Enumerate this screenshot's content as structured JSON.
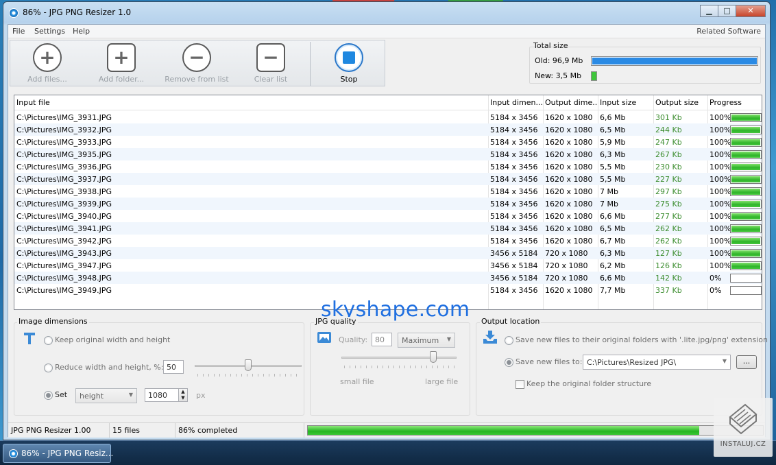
{
  "window": {
    "title": "86% - JPG PNG Resizer 1.0",
    "controls": {
      "minimize": "▁",
      "maximize": "□",
      "close": "✕"
    }
  },
  "menu": {
    "items": [
      "File",
      "Settings",
      "Help"
    ],
    "right": "Related Software"
  },
  "toolbar": {
    "add_files": "Add files...",
    "add_folder": "Add folder...",
    "remove": "Remove from list",
    "clear": "Clear list",
    "stop": "Stop"
  },
  "total_size": {
    "label": "Total size",
    "old_label": "Old: 96,9 Mb",
    "new_label": "New: 3,5 Mb",
    "old_fraction": 1.0,
    "new_fraction": 0.036,
    "old_color": "#2a8ae4",
    "new_color": "#3fc63b"
  },
  "table": {
    "columns": [
      "Input file",
      "Input dimen...",
      "Output dime...",
      "Input size",
      "Output size",
      "Progress"
    ],
    "rows": [
      {
        "file": "C:\\Pictures\\IMG_3931.JPG",
        "in_dim": "5184 x 3456",
        "out_dim": "1620 x 1080",
        "in_size": "6,6 Mb",
        "out_size": "301 Kb",
        "progress": "100%",
        "pct": 100
      },
      {
        "file": "C:\\Pictures\\IMG_3932.JPG",
        "in_dim": "5184 x 3456",
        "out_dim": "1620 x 1080",
        "in_size": "6,5 Mb",
        "out_size": "244 Kb",
        "progress": "100%",
        "pct": 100
      },
      {
        "file": "C:\\Pictures\\IMG_3933.JPG",
        "in_dim": "5184 x 3456",
        "out_dim": "1620 x 1080",
        "in_size": "5,9 Mb",
        "out_size": "247 Kb",
        "progress": "100%",
        "pct": 100
      },
      {
        "file": "C:\\Pictures\\IMG_3935.JPG",
        "in_dim": "5184 x 3456",
        "out_dim": "1620 x 1080",
        "in_size": "6,3 Mb",
        "out_size": "267 Kb",
        "progress": "100%",
        "pct": 100
      },
      {
        "file": "C:\\Pictures\\IMG_3936.JPG",
        "in_dim": "5184 x 3456",
        "out_dim": "1620 x 1080",
        "in_size": "5,5 Mb",
        "out_size": "230 Kb",
        "progress": "100%",
        "pct": 100
      },
      {
        "file": "C:\\Pictures\\IMG_3937.JPG",
        "in_dim": "5184 x 3456",
        "out_dim": "1620 x 1080",
        "in_size": "5,5 Mb",
        "out_size": "227 Kb",
        "progress": "100%",
        "pct": 100
      },
      {
        "file": "C:\\Pictures\\IMG_3938.JPG",
        "in_dim": "5184 x 3456",
        "out_dim": "1620 x 1080",
        "in_size": "7 Mb",
        "out_size": "297 Kb",
        "progress": "100%",
        "pct": 100
      },
      {
        "file": "C:\\Pictures\\IMG_3939.JPG",
        "in_dim": "5184 x 3456",
        "out_dim": "1620 x 1080",
        "in_size": "7 Mb",
        "out_size": "275 Kb",
        "progress": "100%",
        "pct": 100
      },
      {
        "file": "C:\\Pictures\\IMG_3940.JPG",
        "in_dim": "5184 x 3456",
        "out_dim": "1620 x 1080",
        "in_size": "6,6 Mb",
        "out_size": "277 Kb",
        "progress": "100%",
        "pct": 100
      },
      {
        "file": "C:\\Pictures\\IMG_3941.JPG",
        "in_dim": "5184 x 3456",
        "out_dim": "1620 x 1080",
        "in_size": "6,5 Mb",
        "out_size": "262 Kb",
        "progress": "100%",
        "pct": 100
      },
      {
        "file": "C:\\Pictures\\IMG_3942.JPG",
        "in_dim": "5184 x 3456",
        "out_dim": "1620 x 1080",
        "in_size": "6,7 Mb",
        "out_size": "262 Kb",
        "progress": "100%",
        "pct": 100
      },
      {
        "file": "C:\\Pictures\\IMG_3943.JPG",
        "in_dim": "3456 x 5184",
        "out_dim": "720 x 1080",
        "in_size": "6,3 Mb",
        "out_size": "127 Kb",
        "progress": "100%",
        "pct": 100
      },
      {
        "file": "C:\\Pictures\\IMG_3947.JPG",
        "in_dim": "3456 x 5184",
        "out_dim": "720 x 1080",
        "in_size": "6,2 Mb",
        "out_size": "126 Kb",
        "progress": "100%",
        "pct": 100
      },
      {
        "file": "C:\\Pictures\\IMG_3948.JPG",
        "in_dim": "3456 x 5184",
        "out_dim": "720 x 1080",
        "in_size": "6,6 Mb",
        "out_size": "142 Kb",
        "progress": "0%",
        "pct": 0
      },
      {
        "file": "C:\\Pictures\\IMG_3949.JPG",
        "in_dim": "5184 x 3456",
        "out_dim": "1620 x 1080",
        "in_size": "7,7 Mb",
        "out_size": "337 Kb",
        "progress": "0%",
        "pct": 0
      }
    ]
  },
  "watermark": "skyshape.com",
  "image_dimensions": {
    "label": "Image dimensions",
    "keep_original": "Keep original width and height",
    "reduce": "Reduce width and height, %:",
    "reduce_value": "50",
    "set": "Set",
    "set_select": "height",
    "set_value": "1080",
    "unit": "px",
    "slider_fraction": 0.5
  },
  "jpg_quality": {
    "label": "JPG quality",
    "quality_label": "Quality:",
    "quality_value": "80",
    "preset": "Maximum",
    "small_file": "small file",
    "large_file": "large file",
    "slider_fraction": 0.8
  },
  "output_location": {
    "label": "Output location",
    "original_folders": "Save new files to their original folders with '.lite.jpg/png' extension",
    "save_to": "Save new files to:",
    "path": "C:\\Pictures\\Resized JPG\\",
    "browse": "...",
    "keep_structure": "Keep the original folder structure"
  },
  "statusbar": {
    "app": "JPG PNG Resizer 1.00",
    "files": "15 files",
    "completed": "86% completed",
    "fraction": 0.86
  },
  "taskbar": {
    "button": "86% - JPG PNG Resiz..."
  },
  "instaluj": "INSTALUJ.CZ"
}
